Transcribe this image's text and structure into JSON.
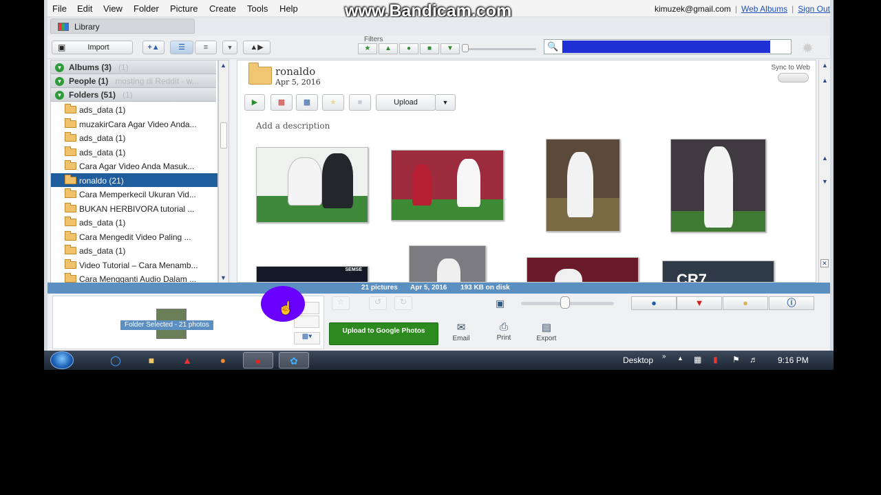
{
  "menubar": {
    "items": [
      "File",
      "Edit",
      "View",
      "Folder",
      "Picture",
      "Create",
      "Tools",
      "Help"
    ],
    "watermark": "www.Bandicam.com",
    "email": "kimuzek@gmail.com",
    "web_albums": "Web Albums",
    "sign_out": "Sign Out",
    "separator": "|"
  },
  "library_tab": {
    "label": "Library"
  },
  "toolbar": {
    "import_label": "Import",
    "filters_label": "Filters",
    "filter_icons": [
      "star-icon",
      "upload-icon",
      "person-icon",
      "movie-icon",
      "geotag-icon"
    ]
  },
  "sidebar": {
    "sections": [
      {
        "label": "Albums (3)",
        "ghost": "(1)"
      },
      {
        "label": "People (1)",
        "ghost": "mosting di Reddit - w..."
      },
      {
        "label": "Folders (51)",
        "ghost": "(1)"
      }
    ],
    "folders": [
      "ads_data (1)",
      "muzakirCara Agar Video Anda...",
      "ads_data (1)",
      "ads_data (1)",
      "Cara Agar Video Anda Masuk...",
      "ronaldo (21)",
      "Cara Memperkecil Ukuran Vid...",
      "BUKAN HERBIVORA  tutorial ...",
      "ads_data (1)",
      "Cara Mengedit Video Paling ...",
      "ads_data (1)",
      "Video Tutorial – Cara Menamb...",
      "Cara Mengganti Audio Dalam ..."
    ],
    "selected_index": 5
  },
  "album": {
    "title": "ronaldo",
    "date": "Apr 5, 2016",
    "sync_label": "Sync to Web",
    "upload_label": "Upload",
    "description_placeholder": "Add a description",
    "photo_overlay_text": [
      "SEMSE",
      "CR7"
    ]
  },
  "status": {
    "count": "21 pictures",
    "date": "Apr 5, 2016",
    "size": "193 KB on disk"
  },
  "tray": {
    "selection_label": "Folder Selected - 21 photos",
    "upload_google": "Upload to Google Photos",
    "email": "Email",
    "print": "Print",
    "export": "Export"
  },
  "taskbar": {
    "desktop_label": "Desktop",
    "clock": "9:16 PM"
  },
  "colors": {
    "selection_blue": "#1f5d9c",
    "status_blue": "#5b8fc2",
    "upload_green": "#2c8a1f",
    "search_highlight": "#1f2fd6",
    "cursor_highlight": "#6a00ff"
  }
}
